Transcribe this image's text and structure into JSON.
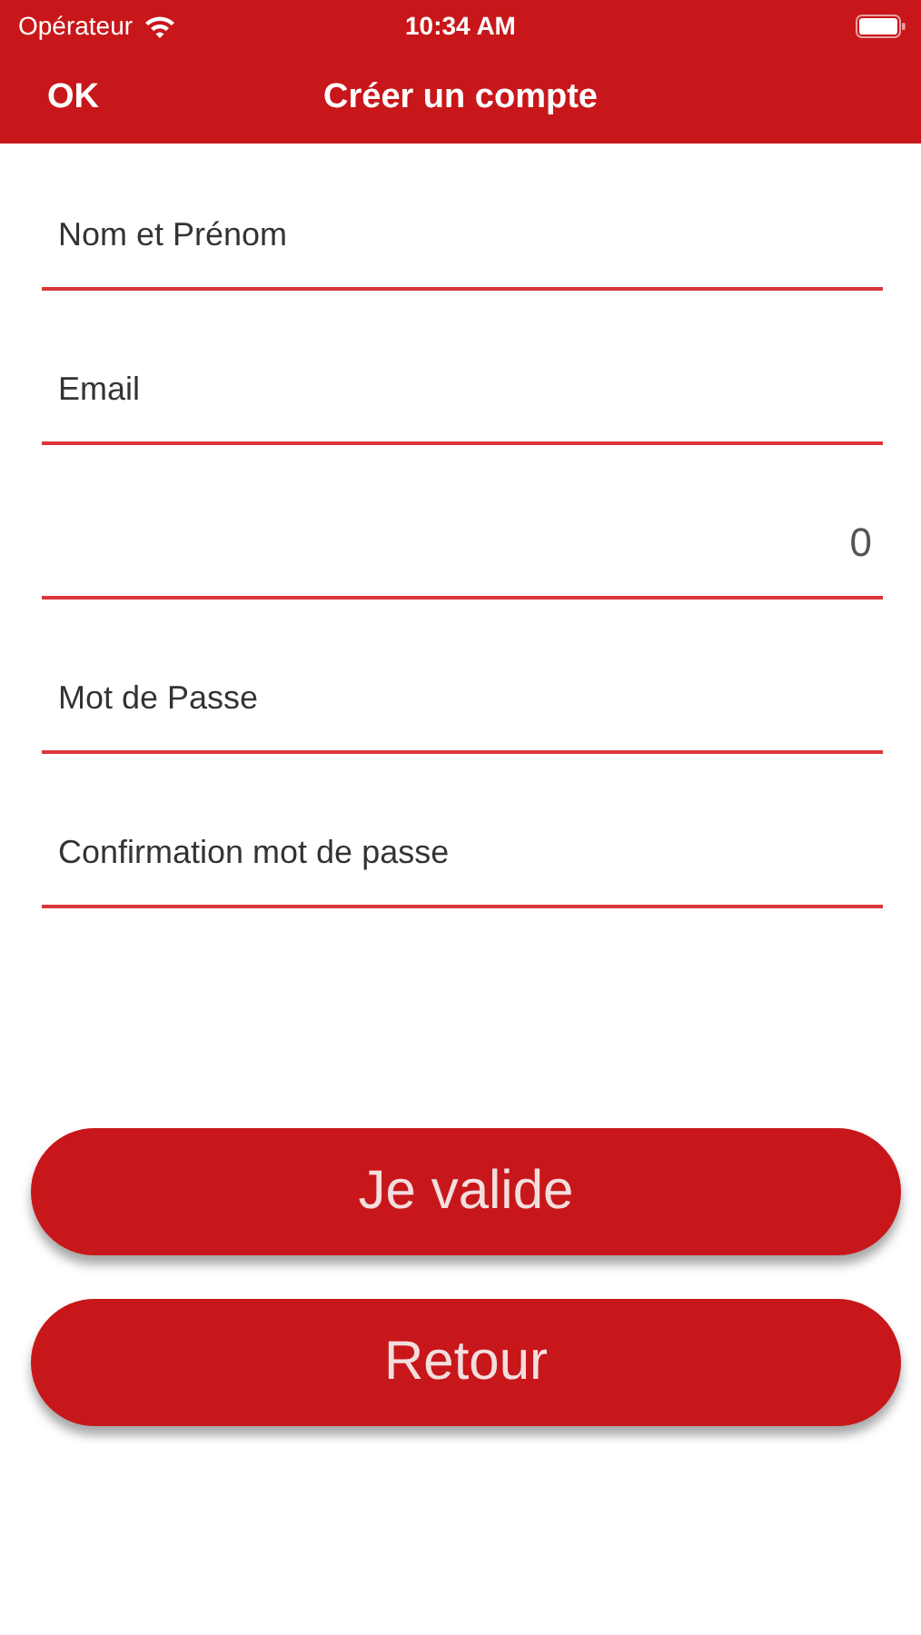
{
  "status_bar": {
    "carrier": "Opérateur",
    "time": "10:34 AM"
  },
  "nav_bar": {
    "left_button": "OK",
    "title": "Créer un compte"
  },
  "fields": [
    {
      "placeholder": "Nom et Prénom"
    },
    {
      "placeholder": "Email"
    },
    {
      "value": "0"
    },
    {
      "placeholder": "Mot de Passe"
    },
    {
      "placeholder": "Confirmation mot de passe"
    }
  ],
  "buttons": [
    "Je valide",
    "Retour"
  ]
}
